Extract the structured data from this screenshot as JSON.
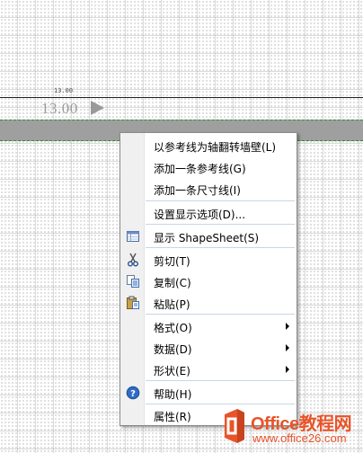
{
  "canvas": {
    "dimension_small": "13.00",
    "dimension_large": "13.00"
  },
  "context_menu": {
    "items": [
      {
        "label": "以参考线为轴翻转墙壁(L)",
        "icon": null,
        "submenu": false
      },
      {
        "label": "添加一条参考线(G)",
        "icon": null,
        "submenu": false
      },
      {
        "label": "添加一条尺寸线(I)",
        "icon": null,
        "submenu": false
      },
      {
        "label": "设置显示选项(D)...",
        "icon": null,
        "submenu": false
      },
      {
        "label": "显示 ShapeSheet(S)",
        "icon": "shapesheet-icon",
        "submenu": false
      },
      {
        "label": "剪切(T)",
        "icon": "scissors-icon",
        "submenu": false
      },
      {
        "label": "复制(C)",
        "icon": "copy-icon",
        "submenu": false
      },
      {
        "label": "粘贴(P)",
        "icon": "paste-icon",
        "submenu": false
      },
      {
        "label": "格式(O)",
        "icon": null,
        "submenu": true
      },
      {
        "label": "数据(D)",
        "icon": null,
        "submenu": true
      },
      {
        "label": "形状(E)",
        "icon": null,
        "submenu": true
      },
      {
        "label": "帮助(H)",
        "icon": "help-icon",
        "submenu": false
      },
      {
        "label": "属性(R)",
        "icon": null,
        "submenu": false
      }
    ]
  },
  "watermark": {
    "title": "Office教程网",
    "url": "www.office26.com"
  },
  "colors": {
    "wall_band": "#9f9f9f",
    "wall_border": "#2e8b2e",
    "watermark": "#e8542a",
    "menu_separator": "#c9d6e6"
  }
}
